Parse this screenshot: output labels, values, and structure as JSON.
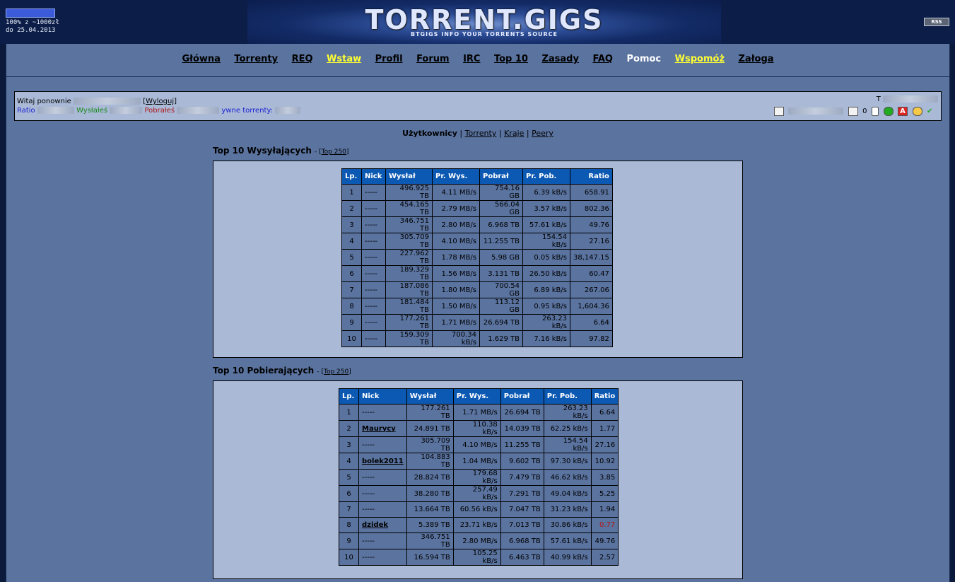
{
  "header": {
    "donation_line1": "100% z ~1000zł",
    "donation_line2": "do 25.04.2013",
    "donation_progress_percent": 100,
    "logo_text": "TORRENT.GIGS",
    "slogan": "BTGIGS INFO YOUR TORRENTS SOURCE",
    "rss_label": "RSS"
  },
  "nav": {
    "items": [
      "Główna",
      "Torrenty",
      "REQ",
      "Wstaw",
      "Profil",
      "Forum",
      "IRC",
      "Top 10",
      "Zasady",
      "FAQ",
      "Pomoc",
      "Wspomóż",
      "Załoga"
    ]
  },
  "userbox": {
    "welcome": "Witaj ponownie",
    "logout": "Wyloguj",
    "ratio_label": "Ratio",
    "uploaded_label": "Wysłałeś",
    "downloaded_label": "Pobrałeś",
    "active_label": "ywne torrenty:",
    "time_label": "T",
    "inbox_count": "0"
  },
  "subnav": {
    "users": "Użytkownicy",
    "torrents": "Torrenty",
    "countries": "Kraje",
    "peers": "Peery",
    "sep": "|"
  },
  "top_uploaders": {
    "title": "Top 10 Wysyłających",
    "dash": "-",
    "link": "Top 250",
    "columns": [
      "Lp.",
      "Nick",
      "Wysłał",
      "Pr. Wys.",
      "Pobrał",
      "Pr. Pob.",
      "Ratio"
    ],
    "rows": [
      [
        "1",
        "-----",
        "496.925 TB",
        "4.11 MB/s",
        "754.16 GB",
        "6.39 kB/s",
        "658.91"
      ],
      [
        "2",
        "-----",
        "454.165 TB",
        "2.79 MB/s",
        "566.04 GB",
        "3.57 kB/s",
        "802.36"
      ],
      [
        "3",
        "-----",
        "346.751 TB",
        "2.80 MB/s",
        "6.968 TB",
        "57.61 kB/s",
        "49.76"
      ],
      [
        "4",
        "-----",
        "305.709 TB",
        "4.10 MB/s",
        "11.255 TB",
        "154.54 kB/s",
        "27.16"
      ],
      [
        "5",
        "-----",
        "227.962 TB",
        "1.78 MB/s",
        "5.98 GB",
        "0.05 kB/s",
        "38,147.15"
      ],
      [
        "6",
        "-----",
        "189.329 TB",
        "1.56 MB/s",
        "3.131 TB",
        "26.50 kB/s",
        "60.47"
      ],
      [
        "7",
        "-----",
        "187.086 TB",
        "1.80 MB/s",
        "700.54 GB",
        "6.89 kB/s",
        "267.06"
      ],
      [
        "8",
        "-----",
        "181.484 TB",
        "1.50 MB/s",
        "113.12 GB",
        "0.95 kB/s",
        "1,604.36"
      ],
      [
        "9",
        "-----",
        "177.261 TB",
        "1.71 MB/s",
        "26.694 TB",
        "263.23 kB/s",
        "6.64"
      ],
      [
        "10",
        "-----",
        "159.309 TB",
        "700.34 kB/s",
        "1.629 TB",
        "7.16 kB/s",
        "97.82"
      ]
    ]
  },
  "top_downloaders": {
    "title": "Top 10 Pobierających",
    "dash": "-",
    "link": "Top 250",
    "columns": [
      "Lp.",
      "Nick",
      "Wysłał",
      "Pr. Wys.",
      "Pobrał",
      "Pr. Pob.",
      "Ratio"
    ],
    "rows": [
      [
        "1",
        "-----",
        "177.261 TB",
        "1.71 MB/s",
        "26.694 TB",
        "263.23 kB/s",
        "6.64"
      ],
      [
        "2",
        "Maurycy",
        "24.891 TB",
        "110.38 kB/s",
        "14.039 TB",
        "62.25 kB/s",
        "1.77"
      ],
      [
        "3",
        "-----",
        "305.709 TB",
        "4.10 MB/s",
        "11.255 TB",
        "154.54 kB/s",
        "27.16"
      ],
      [
        "4",
        "bolek2011",
        "104.883 TB",
        "1.04 MB/s",
        "9.602 TB",
        "97.30 kB/s",
        "10.92"
      ],
      [
        "5",
        "-----",
        "28.824 TB",
        "179.68 kB/s",
        "7.479 TB",
        "46.62 kB/s",
        "3.85"
      ],
      [
        "6",
        "-----",
        "38.280 TB",
        "257.49 kB/s",
        "7.291 TB",
        "49.04 kB/s",
        "5.25"
      ],
      [
        "7",
        "-----",
        "13.664 TB",
        "60.56 kB/s",
        "7.047 TB",
        "31.23 kB/s",
        "1.94"
      ],
      [
        "8",
        "dzidek",
        "5.389 TB",
        "23.71 kB/s",
        "7.013 TB",
        "30.86 kB/s",
        "0.77"
      ],
      [
        "9",
        "-----",
        "346.751 TB",
        "2.80 MB/s",
        "6.968 TB",
        "57.61 kB/s",
        "49.76"
      ],
      [
        "10",
        "-----",
        "16.594 TB",
        "105.25 kB/s",
        "6.463 TB",
        "40.99 kB/s",
        "2.57"
      ]
    ],
    "low_ratio_color": "#b01818"
  },
  "colors": {
    "header_bg": "#0c59b3",
    "page_bg": "#5a739f",
    "box_bg": "#a9b9d6",
    "highlight_yellow": "#ffff33"
  }
}
